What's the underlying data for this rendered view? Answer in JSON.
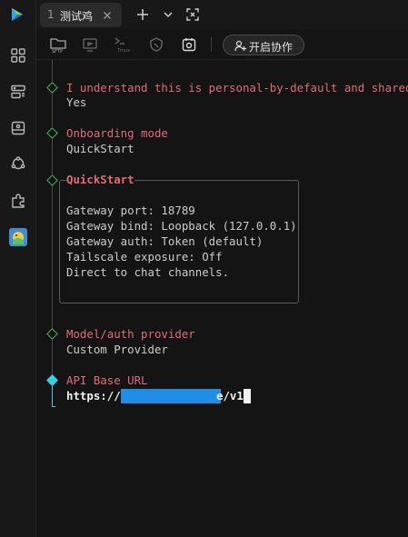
{
  "tab": {
    "number": "1",
    "title": "测试鸡"
  },
  "toolbar": {
    "collab_label": "开启协作"
  },
  "terminal": {
    "q1": "I understand this is personal-by-default and shared/mu",
    "a1": "Yes",
    "q2": "Onboarding mode",
    "a2": "QuickStart",
    "q3": "QuickStart",
    "box_lines": [
      "Gateway port: 18789",
      "Gateway bind: Loopback (127.0.0.1)",
      "Gateway auth: Token (default)",
      "Tailscale exposure: Off",
      "Direct to chat channels."
    ],
    "q4": "Model/auth provider",
    "a4": "Custom Provider",
    "q5": "API Base URL",
    "input_prefix": "https://a",
    "input_suffix": "e/v1"
  },
  "colors": {
    "prompt": "#e06c75",
    "diamond": "#3fb950",
    "active_diamond": "#2bd4e6",
    "redaction": "#1e8fe6"
  },
  "icons": {
    "sidebar": [
      "grid-icon",
      "server-list-icon",
      "terminal-window-icon",
      "network-icon",
      "plugin-icon",
      "avatar-app-icon"
    ],
    "tabbar": [
      "app-logo-icon",
      "close-icon",
      "plus-icon",
      "chevron-down-icon",
      "fullscreen-icon"
    ],
    "toolbar": [
      "sftp-folder-icon",
      "monitor-icon",
      "tmux-icon",
      "shield-icon",
      "record-icon",
      "add-user-icon"
    ]
  }
}
